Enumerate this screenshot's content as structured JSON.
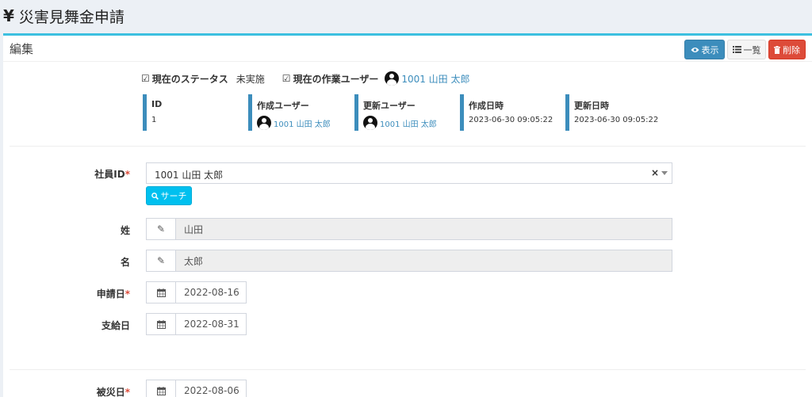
{
  "page": {
    "yen_icon": "¥",
    "title": "災害見舞金申請"
  },
  "box": {
    "title": "編集",
    "buttons": {
      "view": "表示",
      "list": "一覧",
      "delete": "削除"
    }
  },
  "status": {
    "label": "現在のステータス",
    "value": "未実施",
    "user_label": "現在の作業ユーザー",
    "user_value": "1001 山田 太郎"
  },
  "meta": [
    {
      "label": "ID",
      "value": "1"
    },
    {
      "label": "作成ユーザー",
      "value": "1001 山田 太郎"
    },
    {
      "label": "更新ユーザー",
      "value": "1001 山田 太郎"
    },
    {
      "label": "作成日時",
      "value": "2023-06-30 09:05:22"
    },
    {
      "label": "更新日時",
      "value": "2023-06-30 09:05:22"
    }
  ],
  "form": {
    "employee": {
      "label": "社員ID",
      "required": "*",
      "value": "1001 山田 太郎",
      "clear": "×",
      "search_button": "サーチ"
    },
    "last_name": {
      "label": "姓",
      "value": "山田"
    },
    "first_name": {
      "label": "名",
      "value": "太郎"
    },
    "apply_date": {
      "label": "申請日",
      "required": "*",
      "value": "2022-08-16"
    },
    "pay_date": {
      "label": "支給日",
      "value": "2022-08-31"
    },
    "disaster_date": {
      "label": "被災日",
      "required": "*",
      "value": "2022-08-06"
    }
  },
  "colors": {
    "primary": "#3c8dbc",
    "danger": "#dd4b39",
    "info": "#00c0ef",
    "accent_line": "#3cc0e0"
  }
}
